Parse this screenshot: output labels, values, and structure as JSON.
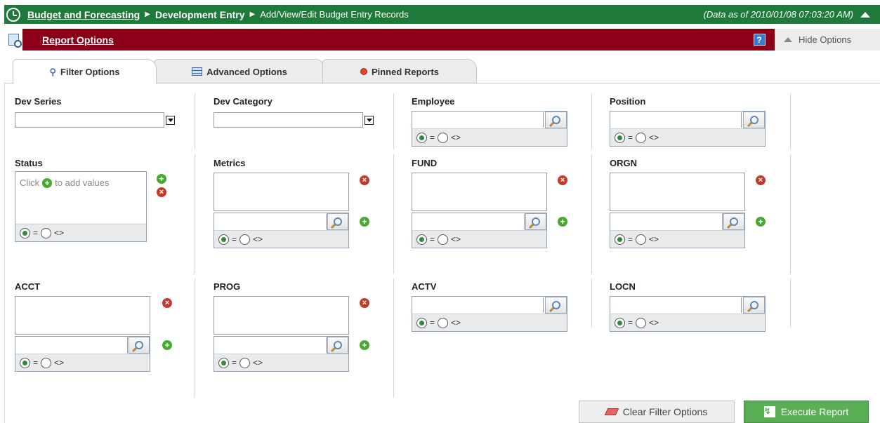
{
  "header": {
    "crumb1": "Budget and Forecasting",
    "crumb2": "Development Entry",
    "crumb3": "Add/View/Edit Budget Entry Records",
    "asof": "(Data as of 2010/01/08 07:03:20 AM)"
  },
  "optbar": {
    "title": "Report Options",
    "help": "?",
    "hide": "Hide Options"
  },
  "tabs": [
    {
      "label": "Filter Options",
      "icon": "magnifier-icon"
    },
    {
      "label": "Advanced Options",
      "icon": "table-icon"
    },
    {
      "label": "Pinned Reports",
      "icon": "pin-icon"
    }
  ],
  "filters": {
    "dev_series": "Dev Series",
    "dev_category": "Dev Category",
    "employee": "Employee",
    "position": "Position",
    "status": "Status",
    "status_hint_pre": "Click",
    "status_hint_post": "to add values",
    "metrics": "Metrics",
    "fund": "FUND",
    "orgn": "ORGN",
    "acct": "ACCT",
    "prog": "PROG",
    "actv": "ACTV",
    "locn": "LOCN",
    "eq": "=",
    "neq": "<>"
  },
  "buttons": {
    "clear": "Clear Filter Options",
    "execute": "Execute Report"
  },
  "colors": {
    "header_green": "#1e7a3a",
    "options_red": "#8b0018",
    "execute_green": "#5aae55"
  }
}
